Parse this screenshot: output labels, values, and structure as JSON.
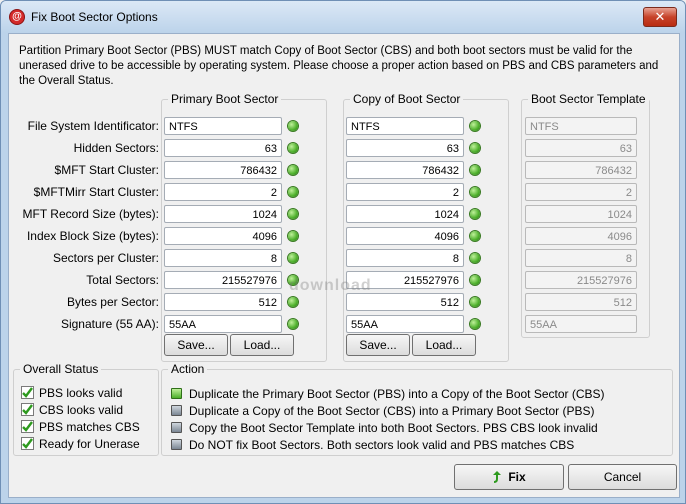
{
  "window": {
    "title": "Fix Boot Sector Options",
    "close_glyph": "✕",
    "app_icon": "@"
  },
  "intro": "Partition Primary Boot Sector (PBS) MUST match Copy of Boot Sector (CBS) and both boot sectors must be valid for the unerased drive to be accessible by operating system. Please choose a proper action based on PBS and CBS parameters and the Overall Status.",
  "groups": {
    "primary": "Primary Boot Sector",
    "copy": "Copy of Boot Sector",
    "template": "Boot Sector Template"
  },
  "rows": [
    {
      "label": "File System Identificator:",
      "pbs": "NTFS",
      "cbs": "NTFS",
      "tpl": "NTFS",
      "align": "left"
    },
    {
      "label": "Hidden Sectors:",
      "pbs": "63",
      "cbs": "63",
      "tpl": "63",
      "align": "right"
    },
    {
      "label": "$MFT Start Cluster:",
      "pbs": "786432",
      "cbs": "786432",
      "tpl": "786432",
      "align": "right"
    },
    {
      "label": "$MFTMirr Start Cluster:",
      "pbs": "2",
      "cbs": "2",
      "tpl": "2",
      "align": "right"
    },
    {
      "label": "MFT Record Size (bytes):",
      "pbs": "1024",
      "cbs": "1024",
      "tpl": "1024",
      "align": "right"
    },
    {
      "label": "Index Block Size (bytes):",
      "pbs": "4096",
      "cbs": "4096",
      "tpl": "4096",
      "align": "right"
    },
    {
      "label": "Sectors per Cluster:",
      "pbs": "8",
      "cbs": "8",
      "tpl": "8",
      "align": "right"
    },
    {
      "label": "Total Sectors:",
      "pbs": "215527976",
      "cbs": "215527976",
      "tpl": "215527976",
      "align": "right"
    },
    {
      "label": "Bytes per Sector:",
      "pbs": "512",
      "cbs": "512",
      "tpl": "512",
      "align": "right"
    },
    {
      "label": "Signature (55 AA):",
      "pbs": "55AA",
      "cbs": "55AA",
      "tpl": "55AA",
      "align": "left"
    }
  ],
  "buttons": {
    "save": "Save...",
    "load": "Load...",
    "fix": "Fix",
    "cancel": "Cancel"
  },
  "status": {
    "title": "Overall Status",
    "items": [
      "PBS looks valid",
      "CBS looks valid",
      "PBS matches CBS",
      "Ready for Unerase"
    ]
  },
  "action": {
    "title": "Action",
    "items": [
      "Duplicate the Primary Boot Sector (PBS) into a Copy of the Boot Sector (CBS)",
      "Duplicate a Copy of the Boot Sector (CBS) into a Primary Boot Sector (PBS)",
      "Copy the Boot Sector Template into both Boot Sectors. PBS  CBS look invalid",
      "Do NOT fix Boot Sectors. Both sectors look valid and PBS matches CBS"
    ],
    "selected_index": 0
  },
  "watermark": "download",
  "colors": {
    "led_green": "#4caf2a",
    "check_green": "#2e9a1f",
    "title_gradient_top": "#dbe8f6"
  }
}
